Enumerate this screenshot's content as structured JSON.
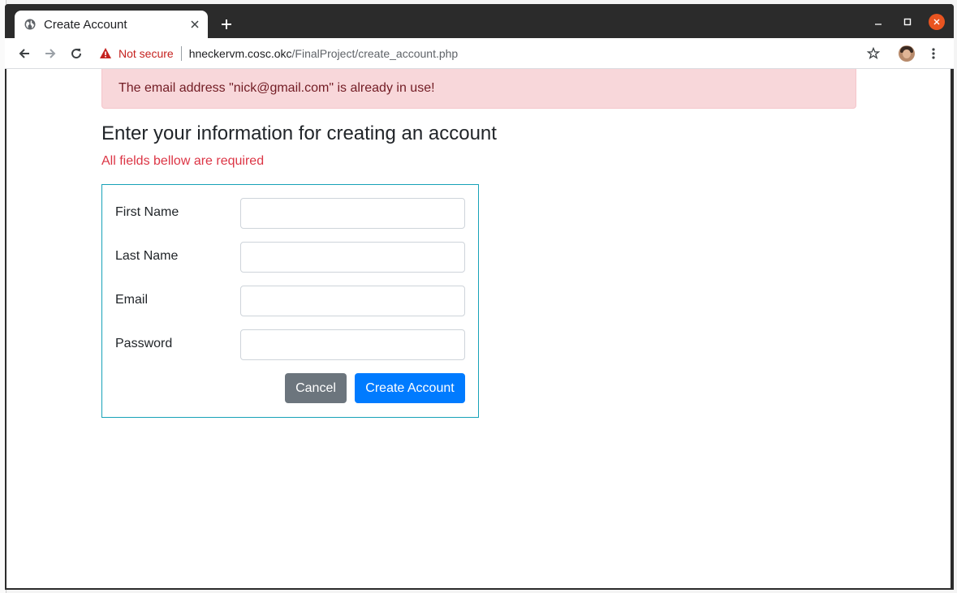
{
  "browser": {
    "tab_title": "Create Account",
    "security_label": "Not secure",
    "url_host": "hneckervm.cosc.okc",
    "url_path": "/FinalProject/create_account.php"
  },
  "page": {
    "alert_message": "The email address \"nick@gmail.com\" is already in use!",
    "heading": "Enter your information for creating an account",
    "required_note": "All fields bellow are required"
  },
  "form": {
    "fields": [
      {
        "label": "First Name",
        "value": "",
        "placeholder": ""
      },
      {
        "label": "Last Name",
        "value": "",
        "placeholder": ""
      },
      {
        "label": "Email",
        "value": "",
        "placeholder": ""
      },
      {
        "label": "Password",
        "value": "",
        "placeholder": ""
      }
    ],
    "cancel_label": "Cancel",
    "submit_label": "Create Account"
  },
  "colors": {
    "alert_bg": "#f8d7da",
    "alert_text": "#721c24",
    "required_text": "#dc3545",
    "form_border": "#17a2b8",
    "cancel_bg": "#6c757d",
    "submit_bg": "#007bff"
  },
  "icons": {
    "tab_favicon": "globe-icon",
    "security": "warning-icon",
    "back": "back-arrow-icon",
    "forward": "forward-arrow-icon",
    "reload": "reload-icon",
    "bookmark": "star-icon",
    "menu": "kebab-menu-icon"
  }
}
